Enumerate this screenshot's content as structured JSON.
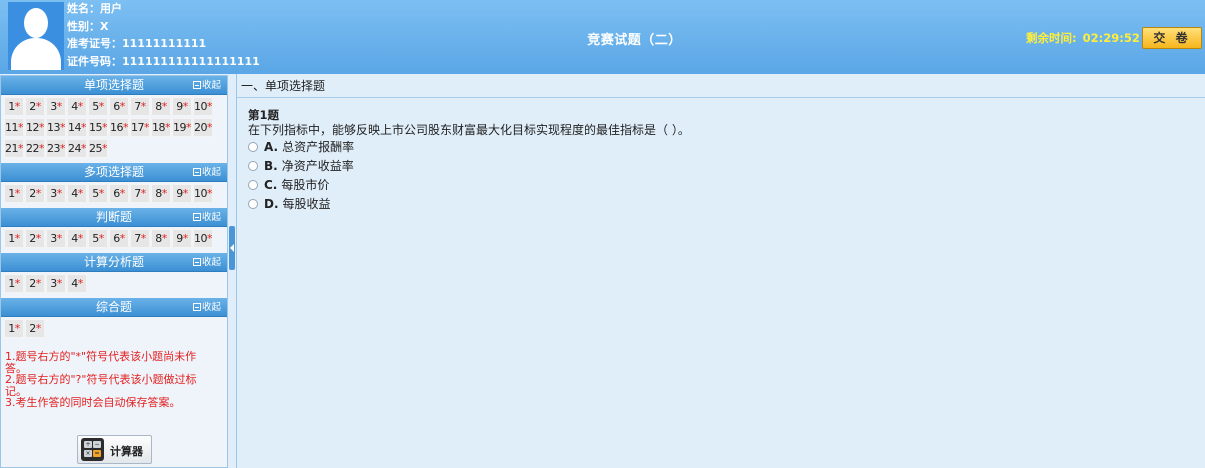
{
  "candidate": {
    "name_label": "姓名：",
    "name": "用户",
    "gender_label": "性别：",
    "gender": "X",
    "exam_id_label": "准考证号：",
    "exam_id": "11111111111",
    "cert_label": "证件号码：",
    "cert_no": "111111111111111111"
  },
  "exam_title": "竞赛试题（二）",
  "timer": {
    "label": "剩余时间:",
    "value": "02:29:52"
  },
  "submit_label": "交 卷",
  "sidebar": {
    "collapse_label": "收起",
    "sections": [
      {
        "title": "单项选择题",
        "questions": [
          "1",
          "2",
          "3",
          "4",
          "5",
          "6",
          "7",
          "8",
          "9",
          "10",
          "11",
          "12",
          "13",
          "14",
          "15",
          "16",
          "17",
          "18",
          "19",
          "20",
          "21",
          "22",
          "23",
          "24",
          "25"
        ]
      },
      {
        "title": "多项选择题",
        "questions": [
          "1",
          "2",
          "3",
          "4",
          "5",
          "6",
          "7",
          "8",
          "9",
          "10"
        ]
      },
      {
        "title": "判断题",
        "questions": [
          "1",
          "2",
          "3",
          "4",
          "5",
          "6",
          "7",
          "8",
          "9",
          "10"
        ]
      },
      {
        "title": "计算分析题",
        "questions": [
          "1",
          "2",
          "3",
          "4"
        ]
      },
      {
        "title": "综合题",
        "questions": [
          "1",
          "2"
        ]
      }
    ],
    "unanswered_mark": "*",
    "notes": [
      "1.题号右方的\"*\"符号代表该小题尚未作答。",
      "2.题号右方的\"?\"符号代表该小题做过标记。",
      "3.考生作答的同时会自动保存答案。"
    ],
    "calculator_label": "计算器",
    "calculator_keys": [
      "+",
      "−",
      "×",
      "="
    ]
  },
  "main": {
    "section_title": "一、单项选择题",
    "question_number": "第1题",
    "question_text": "在下列指标中，能够反映上市公司股东财富最大化目标实现程度的最佳指标是（  ）。",
    "options": [
      {
        "letter": "A.",
        "text": "总资产报酬率"
      },
      {
        "letter": "B.",
        "text": "净资产收益率"
      },
      {
        "letter": "C.",
        "text": "每股市价"
      },
      {
        "letter": "D.",
        "text": "每股收益"
      }
    ]
  },
  "colors": {
    "header": "#6ab1ec",
    "timer": "#ffef3a",
    "submit": "#f6b51c",
    "unanswered_star": "#e02020",
    "notes": "#e31f1f"
  }
}
